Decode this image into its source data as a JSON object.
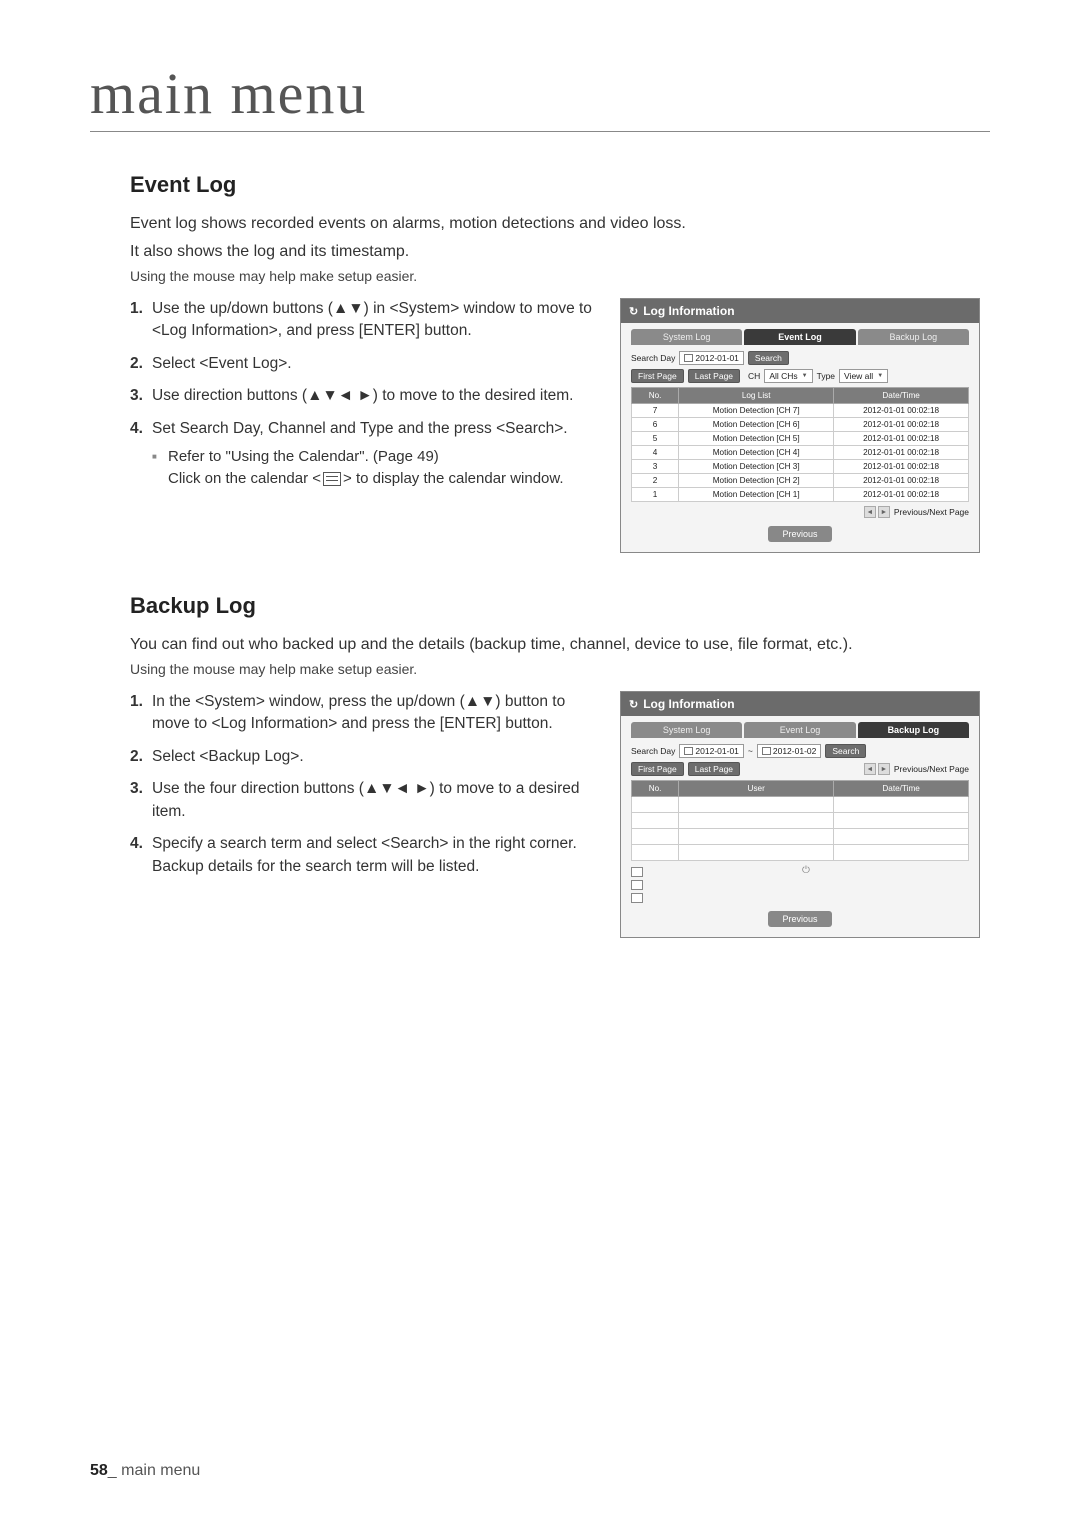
{
  "page": {
    "title": "main menu",
    "footer_page": "58",
    "footer_sep": "_",
    "footer_label": "main menu"
  },
  "event_log": {
    "heading": "Event Log",
    "intro_line1": "Event log shows recorded events on alarms, motion detections and video loss.",
    "intro_line2": "It also shows the log and its timestamp.",
    "mouse_note": "Using the mouse may help make setup easier.",
    "steps": {
      "s1": "Use the up/down buttons (▲▼) in <System> window to move to <Log Information>, and press [ENTER] button.",
      "s2": "Select <Event Log>.",
      "s3": "Use direction buttons (▲▼◄ ►) to move to the desired item.",
      "s4": "Set Search Day, Channel and Type and the press <Search>.",
      "s4_note_a": "Refer to \"Using the Calendar\". (Page 49)",
      "s4_note_b_prefix": "Click on the calendar <",
      "s4_note_b_suffix": "> to display the calendar window."
    },
    "panel": {
      "title": "Log Information",
      "tabs": {
        "t1": "System Log",
        "t2": "Event Log",
        "t3": "Backup Log"
      },
      "labels": {
        "search_day": "Search Day",
        "ch": "CH",
        "type": "Type",
        "first_page": "First Page",
        "last_page": "Last Page",
        "prev_next": "Previous/Next Page",
        "search_btn": "Search",
        "previous": "Previous",
        "date_val": "2012-01-01",
        "all_chs": "All CHs",
        "view_all": "View all"
      },
      "table": {
        "cols": {
          "no": "No.",
          "log": "Log List",
          "dt": "Date/Time"
        },
        "rows": [
          {
            "no": "7",
            "log": "Motion Detection [CH 7]",
            "dt": "2012-01-01 00:02:18"
          },
          {
            "no": "6",
            "log": "Motion Detection [CH 6]",
            "dt": "2012-01-01 00:02:18"
          },
          {
            "no": "5",
            "log": "Motion Detection [CH 5]",
            "dt": "2012-01-01 00:02:18"
          },
          {
            "no": "4",
            "log": "Motion Detection [CH 4]",
            "dt": "2012-01-01 00:02:18"
          },
          {
            "no": "3",
            "log": "Motion Detection [CH 3]",
            "dt": "2012-01-01 00:02:18"
          },
          {
            "no": "2",
            "log": "Motion Detection [CH 2]",
            "dt": "2012-01-01 00:02:18"
          },
          {
            "no": "1",
            "log": "Motion Detection [CH 1]",
            "dt": "2012-01-01 00:02:18"
          }
        ]
      }
    }
  },
  "backup_log": {
    "heading": "Backup Log",
    "intro": "You can find out who backed up and the details (backup time, channel, device to use, file format, etc.).",
    "mouse_note": "Using the mouse may help make setup easier.",
    "steps": {
      "s1": "In the <System> window, press the up/down (▲▼) button to move to <Log Information> and press the [ENTER] button.",
      "s2": "Select <Backup Log>.",
      "s3": "Use the four direction buttons (▲▼◄ ►) to move to a desired item.",
      "s4a": "Specify a search term and select <Search> in the right corner.",
      "s4b": "Backup details for the search term will be listed."
    },
    "panel": {
      "title": "Log Information",
      "tabs": {
        "t1": "System Log",
        "t2": "Event Log",
        "t3": "Backup Log"
      },
      "labels": {
        "search_day": "Search Day",
        "first_page": "First Page",
        "last_page": "Last Page",
        "prev_next": "Previous/Next Page",
        "search_btn": "Search",
        "previous": "Previous",
        "date_from": "2012-01-01",
        "date_to": "2012-01-02",
        "range_sep": "~"
      },
      "table": {
        "cols": {
          "no": "No.",
          "user": "User",
          "dt": "Date/Time"
        }
      }
    }
  }
}
